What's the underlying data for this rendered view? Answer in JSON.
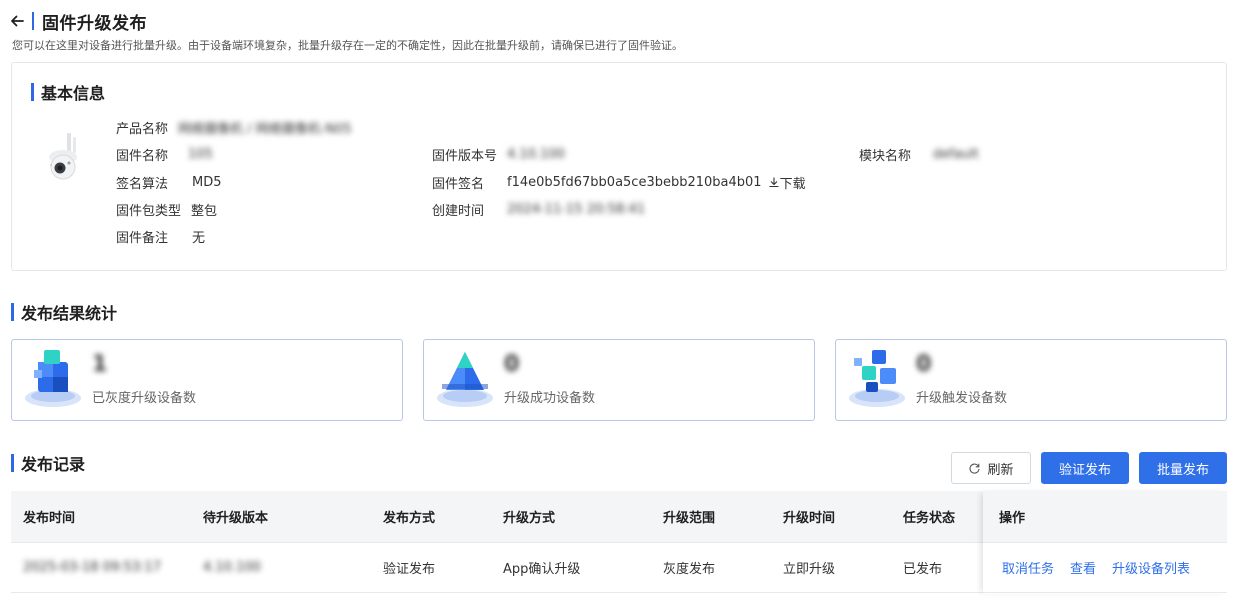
{
  "header": {
    "title": "固件升级发布",
    "description": "您可以在这里对设备进行批量升级。由于设备端环境复杂，批量升级存在一定的不确定性，因此在批量升级前，请确保已进行了固件验证。"
  },
  "basic_info": {
    "section_title": "基本信息",
    "product_name_label": "产品名称",
    "product_name_value": "网络摄像机 / 网络摄像机-N05",
    "firmware_name_label": "固件名称",
    "firmware_name_value": "105",
    "firmware_version_label": "固件版本号",
    "firmware_version_value": "4.10.100",
    "module_name_label": "模块名称",
    "module_name_value": "default",
    "sign_algo_label": "签名算法",
    "sign_algo_value": "MD5",
    "firmware_sign_label": "固件签名",
    "firmware_sign_value": "f14e0b5fd67bb0a5ce3bebb210ba4b01",
    "download_label": "下载",
    "package_type_label": "固件包类型",
    "package_type_value": "整包",
    "created_time_label": "创建时间",
    "created_time_value": "2024-11-15 20:58:41",
    "remark_label": "固件备注",
    "remark_value": "无"
  },
  "stats": {
    "section_title": "发布结果统计",
    "cards": [
      {
        "value": "1",
        "label": "已灰度升级设备数",
        "icon": "cube-stack-icon"
      },
      {
        "value": "0",
        "label": "升级成功设备数",
        "icon": "pyramid-icon"
      },
      {
        "value": "0",
        "label": "升级触发设备数",
        "icon": "blocks-icon"
      }
    ]
  },
  "records": {
    "section_title": "发布记录",
    "refresh_label": "刷新",
    "verify_publish_label": "验证发布",
    "batch_publish_label": "批量发布",
    "columns": [
      "发布时间",
      "待升级版本",
      "发布方式",
      "升级方式",
      "升级范围",
      "升级时间",
      "任务状态",
      "操作"
    ],
    "rows": [
      {
        "publish_time": "2025-03-18 09:53:17",
        "target_version": "4.10.100",
        "publish_method": "验证发布",
        "upgrade_method": "App确认升级",
        "upgrade_scope": "灰度发布",
        "upgrade_time": "立即升级",
        "status": "已发布",
        "actions": [
          "取消任务",
          "查看",
          "升级设备列表"
        ]
      }
    ]
  },
  "colors": {
    "accent": "#2f6fe8",
    "section_bar": "#2f67e8",
    "card_border": "#b9c6e6"
  }
}
